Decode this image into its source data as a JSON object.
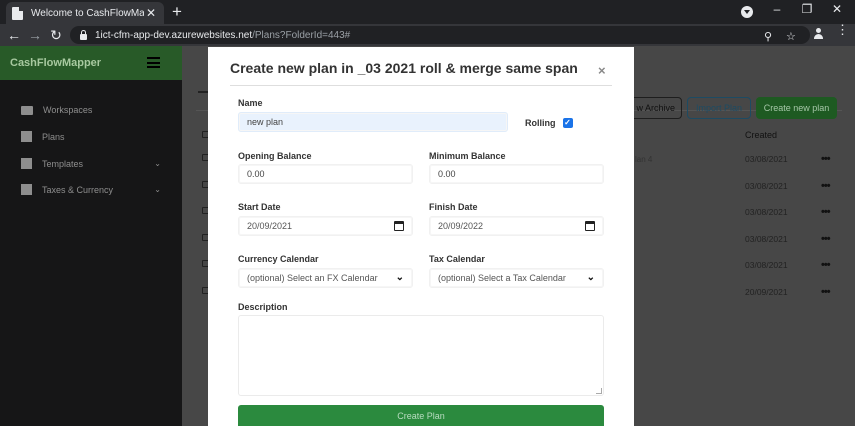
{
  "browser": {
    "tab_title": "Welcome to CashFlowMapper",
    "tab_close": "✕",
    "new_tab": "+",
    "url_host": "1ict-cfm-app-dev.azurewebsites.net",
    "url_path": "/Plans?FolderId=443#",
    "back": "←",
    "forward": "→",
    "reload": "↻",
    "search_icon": "⚲",
    "star_icon": "☆",
    "window_minimize": "–",
    "window_restore": "❐",
    "window_close": "✕",
    "menu_icon": "⋮"
  },
  "app": {
    "logo": "CashFlowMapper",
    "accent_color": "#285a28"
  },
  "sidebar": {
    "items": [
      {
        "label": "Workspaces",
        "icon": "folder-icon"
      },
      {
        "label": "Plans",
        "icon": "checkbox-icon"
      },
      {
        "label": "Templates",
        "icon": "download-icon",
        "chevron": "⌄"
      },
      {
        "label": "Taxes & Currency",
        "icon": "calendar-icon",
        "chevron": "⌄"
      }
    ]
  },
  "content": {
    "buttons": {
      "archive": "w Archive",
      "import": "Import Plan",
      "new_plan": "Create new plan"
    },
    "created_header": "Created",
    "rows": [
      {
        "name": "lan 4",
        "date": "03/08/2021"
      },
      {
        "name": "",
        "date": "03/08/2021"
      },
      {
        "name": "",
        "date": "03/08/2021"
      },
      {
        "name": "",
        "date": "03/08/2021"
      },
      {
        "name": "",
        "date": "03/08/2021"
      },
      {
        "name": "",
        "date": "20/09/2021"
      }
    ],
    "row_menu": "•••"
  },
  "modal": {
    "title": "Create new plan in _03 2021 roll & merge same span",
    "close": "×",
    "name_label": "Name",
    "name_value": "new plan",
    "rolling_label": "Rolling",
    "rolling_checked": true,
    "rolling_check": "✓",
    "opening_balance_label": "Opening Balance",
    "opening_balance_value": "0.00",
    "minimum_balance_label": "Minimum Balance",
    "minimum_balance_value": "0.00",
    "start_date_label": "Start Date",
    "start_date_value": "20/09/2021",
    "finish_date_label": "Finish Date",
    "finish_date_value": "20/09/2022",
    "currency_calendar_label": "Currency Calendar",
    "currency_calendar_value": "(optional) Select an FX Calendar",
    "tax_calendar_label": "Tax Calendar",
    "tax_calendar_value": "(optional) Select a Tax Calendar",
    "description_label": "Description",
    "description_value": "",
    "submit_label": "Create Plan",
    "dropdown_glyph": "⌄"
  }
}
